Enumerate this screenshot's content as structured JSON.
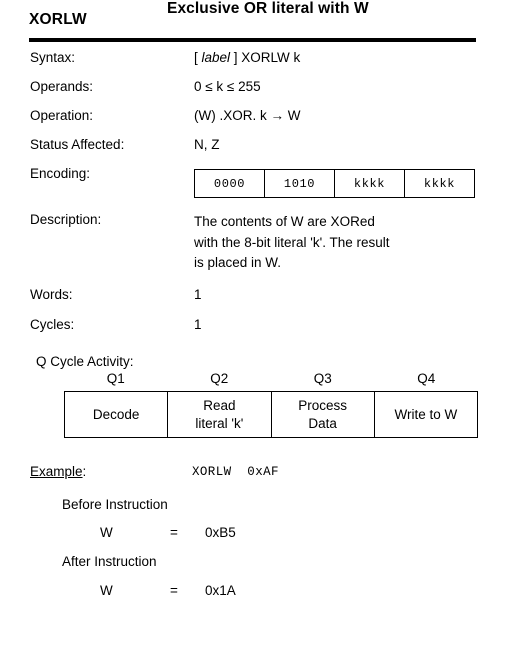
{
  "header": {
    "mnemonic": "XORLW",
    "title": "Exclusive OR literal with W"
  },
  "fields": [
    {
      "label": "Syntax:",
      "value_prefix": "[ ",
      "value_italic": "label",
      "value_suffix": " ] XORLW   k"
    },
    {
      "label": "Operands:",
      "value": "0 ≤ k ≤ 255"
    },
    {
      "label": "Operation:",
      "value": "(W) .XOR. k → W"
    },
    {
      "label": "Status Affected:",
      "value": "N, Z"
    },
    {
      "label": "Encoding:"
    },
    {
      "label": "Description:"
    },
    {
      "label": "Words:",
      "value": "1"
    },
    {
      "label": "Cycles:",
      "value": "1"
    }
  ],
  "encoding": {
    "cells": [
      "0000",
      "1010",
      "kkkk",
      "kkkk"
    ]
  },
  "description": {
    "lines": [
      "The contents of W are XORed",
      "with the 8-bit literal 'k'. The result",
      "is placed in W."
    ]
  },
  "q_cycle": {
    "title": "Q Cycle Activity:",
    "headers": [
      "Q1",
      "Q2",
      "Q3",
      "Q4"
    ],
    "cells": [
      {
        "line1": "Decode",
        "line2": ""
      },
      {
        "line1": "Read",
        "line2": "literal 'k'"
      },
      {
        "line1": "Process",
        "line2": "Data"
      },
      {
        "line1": "Write to W",
        "line2": ""
      }
    ]
  },
  "example": {
    "label_underlined": "Example",
    "label_suffix": ":",
    "code": "XORLW  0xAF",
    "before_heading": "Before Instruction",
    "before_register": "W",
    "before_equals": "=",
    "before_value": "0xB5",
    "after_heading": "After Instruction",
    "after_register": "W",
    "after_equals": "=",
    "after_value": "0x1A"
  }
}
